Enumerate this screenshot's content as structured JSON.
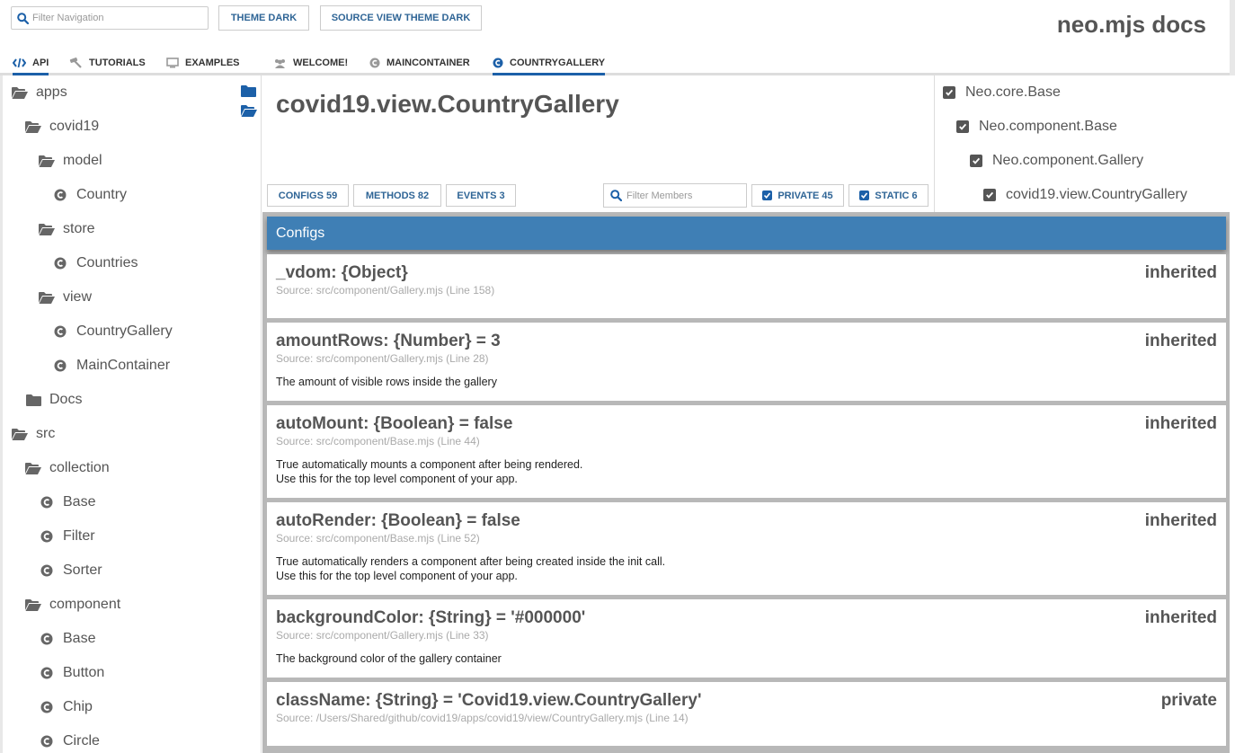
{
  "header": {
    "nav_filter_placeholder": "Filter Navigation",
    "theme_dark_label": "THEME DARK",
    "source_view_theme_dark_label": "SOURCE VIEW THEME DARK",
    "brand": "neo.mjs docs"
  },
  "tabs": [
    {
      "label": "API",
      "icon": "code-icon",
      "active": true
    },
    {
      "label": "TUTORIALS",
      "icon": "hammer-icon"
    },
    {
      "label": "EXAMPLES",
      "icon": "desktop-icon"
    },
    {
      "label": "WELCOME!",
      "icon": "users-icon"
    },
    {
      "label": "MAINCONTAINER",
      "icon": "class-icon"
    },
    {
      "label": "COUNTRYGALLERY",
      "icon": "class-icon",
      "active": true
    }
  ],
  "sidebar": {
    "items": [
      {
        "label": "apps",
        "type": "folder-open",
        "level": 0
      },
      {
        "label": "covid19",
        "type": "folder-open",
        "level": 1
      },
      {
        "label": "model",
        "type": "folder-open",
        "level": 2
      },
      {
        "label": "Country",
        "type": "class",
        "level": 3
      },
      {
        "label": "store",
        "type": "folder-open",
        "level": 2
      },
      {
        "label": "Countries",
        "type": "class",
        "level": 3
      },
      {
        "label": "view",
        "type": "folder-open",
        "level": 2
      },
      {
        "label": "CountryGallery",
        "type": "class",
        "level": 3
      },
      {
        "label": "MainContainer",
        "type": "class",
        "level": 3
      },
      {
        "label": "Docs",
        "type": "folder",
        "level": 1
      },
      {
        "label": "src",
        "type": "folder-open",
        "level": 0
      },
      {
        "label": "collection",
        "type": "folder-open",
        "level": 1
      },
      {
        "label": "Base",
        "type": "class",
        "level": 2
      },
      {
        "label": "Filter",
        "type": "class",
        "level": 2
      },
      {
        "label": "Sorter",
        "type": "class",
        "level": 2
      },
      {
        "label": "component",
        "type": "folder-open",
        "level": 1
      },
      {
        "label": "Base",
        "type": "class",
        "level": 2
      },
      {
        "label": "Button",
        "type": "class",
        "level": 2
      },
      {
        "label": "Chip",
        "type": "class",
        "level": 2
      },
      {
        "label": "Circle",
        "type": "class",
        "level": 2
      }
    ]
  },
  "main": {
    "class_title": "covid19.view.CountryGallery",
    "configs_btn": "CONFIGS 59",
    "methods_btn": "METHODS 82",
    "events_btn": "EVENTS 3",
    "filter_members_placeholder": "Filter Members",
    "private_btn": "PRIVATE 45",
    "static_btn": "STATIC 6"
  },
  "hierarchy": [
    "Neo.core.Base",
    "Neo.component.Base",
    "Neo.component.Gallery",
    "covid19.view.CountryGallery"
  ],
  "members": {
    "section_title": "Configs",
    "items": [
      {
        "name": "_vdom: {Object}",
        "tag": "inherited",
        "source": "Source: src/component/Gallery.mjs (Line 158)",
        "desc": []
      },
      {
        "name": "amountRows: {Number} = 3",
        "tag": "inherited",
        "source": "Source: src/component/Gallery.mjs (Line 28)",
        "desc": [
          "The amount of visible rows inside the gallery"
        ]
      },
      {
        "name": "autoMount: {Boolean} = false",
        "tag": "inherited",
        "source": "Source: src/component/Base.mjs (Line 44)",
        "desc": [
          "True automatically mounts a component after being rendered.",
          "Use this for the top level component of your app."
        ]
      },
      {
        "name": "autoRender: {Boolean} = false",
        "tag": "inherited",
        "source": "Source: src/component/Base.mjs (Line 52)",
        "desc": [
          "True automatically renders a component after being created inside the init call.",
          "Use this for the top level component of your app."
        ]
      },
      {
        "name": "backgroundColor: {String} = '#000000'",
        "tag": "inherited",
        "source": "Source: src/component/Gallery.mjs (Line 33)",
        "desc": [
          "The background color of the gallery container"
        ]
      },
      {
        "name": "className: {String} = 'Covid19.view.CountryGallery'",
        "tag": "private",
        "source": "Source: /Users/Shared/github/covid19/apps/covid19/view/CountryGallery.mjs (Line 14)",
        "desc": []
      }
    ]
  },
  "colors": {
    "accent": "#1c60a8",
    "section_header": "#3f7fb5",
    "button_text": "#2f6596"
  }
}
